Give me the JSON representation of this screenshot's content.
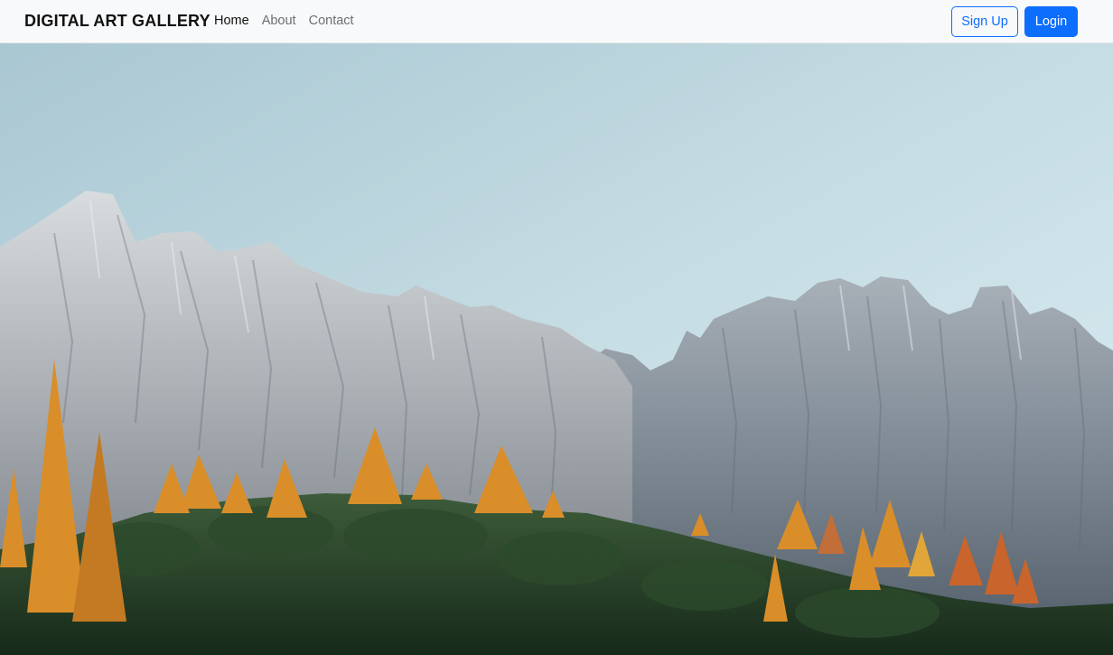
{
  "navbar": {
    "brand": "DIGITAL ART GALLERY",
    "links": [
      {
        "label": "Home",
        "active": true
      },
      {
        "label": "About",
        "active": false
      },
      {
        "label": "Contact",
        "active": false
      }
    ],
    "signup_label": "Sign Up",
    "login_label": "Login"
  },
  "hero": {
    "image": "mountain-landscape-photo"
  },
  "colors": {
    "accent": "#0d6efd",
    "navbar_bg": "#f8f9fa"
  }
}
